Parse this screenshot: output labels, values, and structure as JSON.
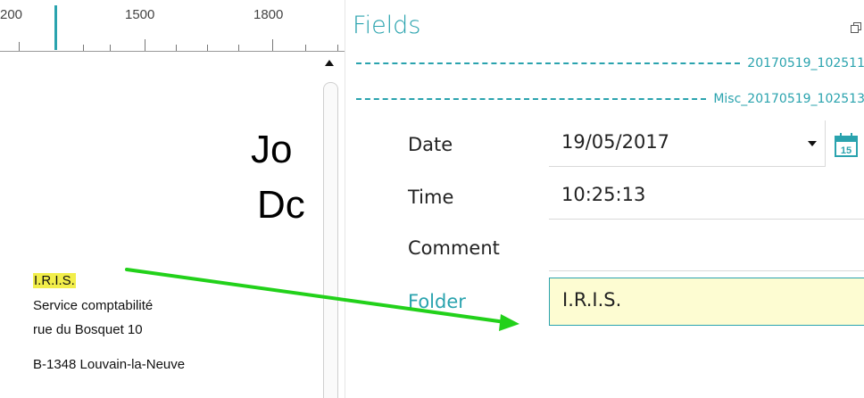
{
  "ruler": {
    "labels": [
      "200",
      "1500",
      "1800"
    ]
  },
  "document": {
    "big_text_line1": "Jo",
    "big_text_line2": "Dc",
    "address": {
      "company": "I.R.I.S.",
      "department": "Service comptabilité",
      "street": "rue du Bosquet 10",
      "city": "B-1348   Louvain-la-Neuve"
    }
  },
  "panel": {
    "title": "Fields",
    "group1": "20170519_102511",
    "group2": "Misc_20170519_102513",
    "fields": [
      {
        "label": "Date",
        "value": "19/05/2017"
      },
      {
        "label": "Time",
        "value": "10:25:13"
      },
      {
        "label": "Comment",
        "value": ""
      },
      {
        "label": "Folder",
        "value": "I.R.I.S."
      }
    ]
  },
  "colors": {
    "accent": "#2aa3ae",
    "highlight": "#f2ee4a",
    "arrow": "#22d11a",
    "folder_bg": "#fdfcd2"
  },
  "icons": [
    "scroll-up-icon",
    "restore-window-icon",
    "dropdown-caret-icon",
    "calendar-icon"
  ]
}
